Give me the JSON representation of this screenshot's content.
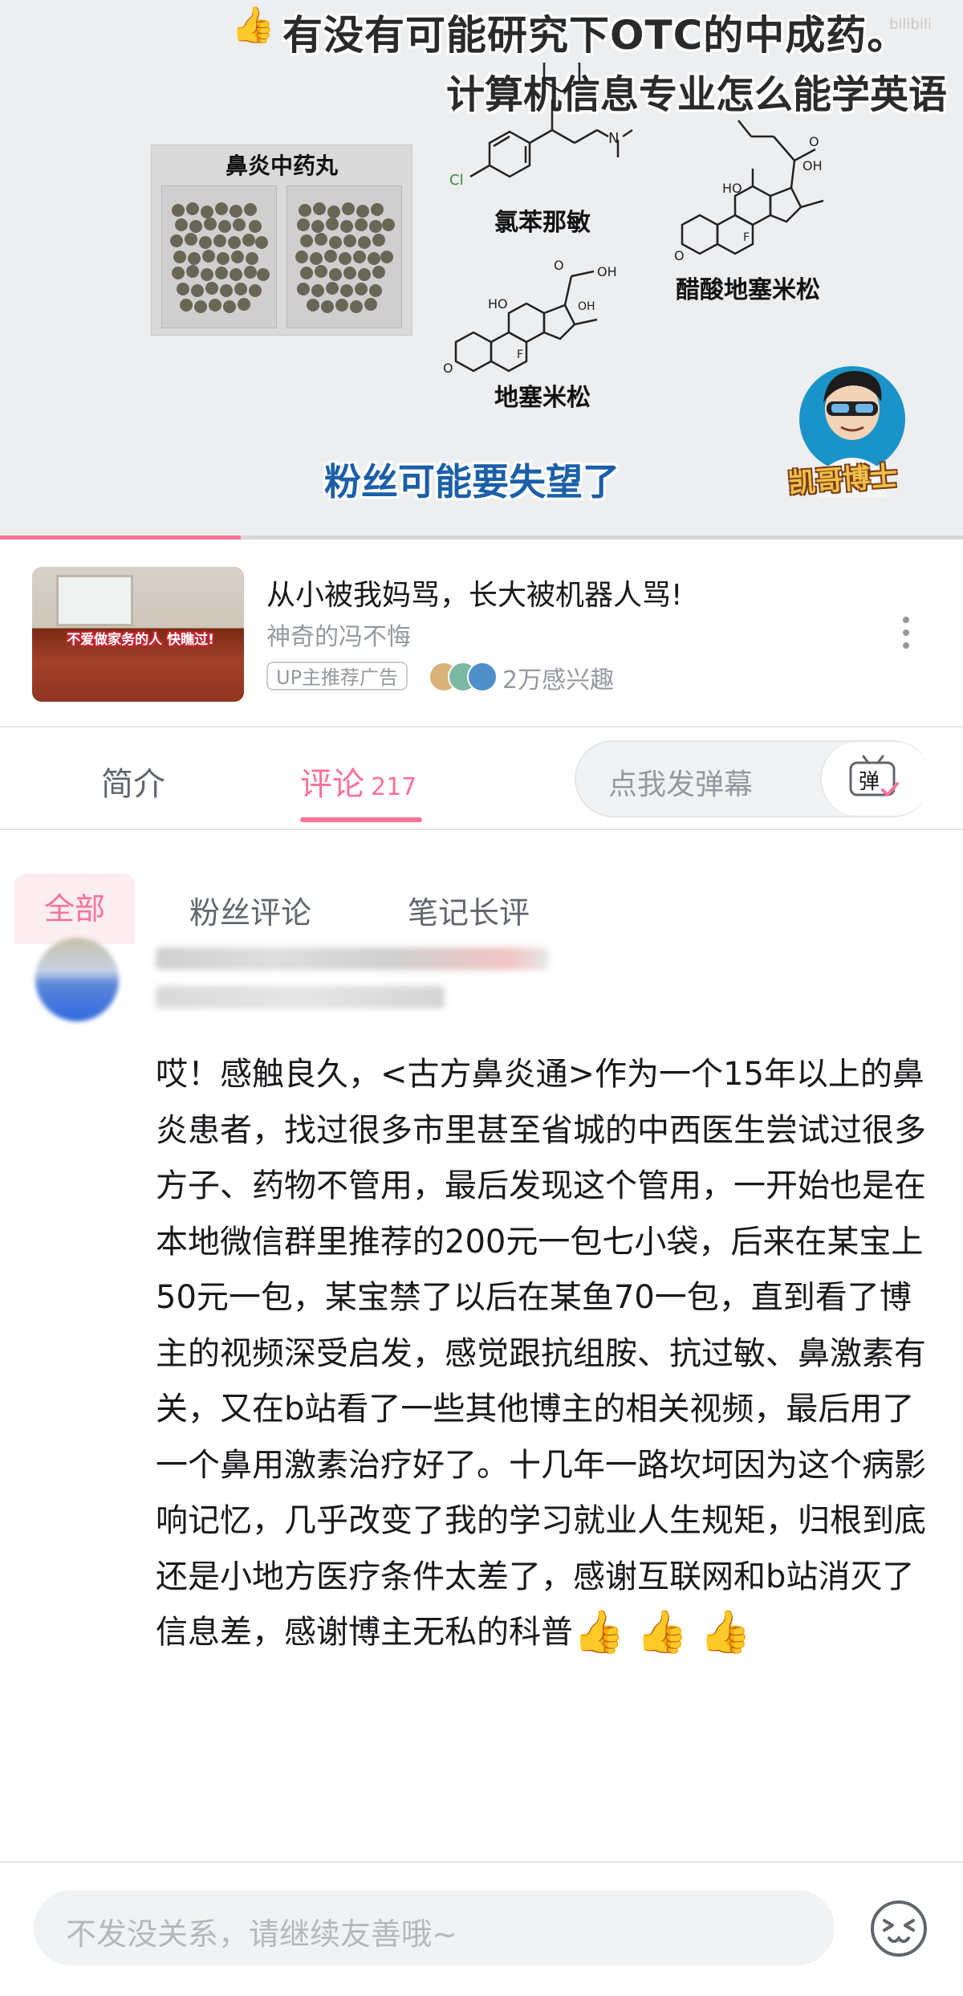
{
  "video": {
    "caption_top": "有没有可能研究下OTC的中成药。",
    "caption_second": "计算机信息专业怎么能学英语",
    "watermark": "bilibili",
    "pill_panel_label": "鼻炎中药丸",
    "chem_labels": [
      "氯苯那敏",
      "醋酸地塞米松",
      "地塞米松"
    ],
    "fans_caption": "粉丝可能要失望了",
    "channel_logo_text": "凯哥博士",
    "progress": 0.25
  },
  "ad": {
    "thumb_caption": "不爱做家务的人 快瞧过!",
    "title": "从小被我妈骂，长大被机器人骂!",
    "author": "神奇的冯不悔",
    "badge": "UP主推荐广告",
    "interest": "2万感兴趣"
  },
  "tabs": {
    "intro": "简介",
    "comments": "评论",
    "comments_count": "217",
    "danmu_placeholder": "点我发弹幕",
    "danmu_button": "弹"
  },
  "filters": {
    "all": "全部",
    "fans": "粉丝评论",
    "notes": "笔记长评"
  },
  "comment": {
    "text": "哎！感触良久，<古方鼻炎通>作为一个15年以上的鼻炎患者，找过很多市里甚至省城的中西医生尝试过很多方子、药物不管用，最后发现这个管用，一开始也是在本地微信群里推荐的200元一包七小袋，后来在某宝上50元一包，某宝禁了以后在某鱼70一包，直到看了博主的视频深受启发，感觉跟抗组胺、抗过敏、鼻激素有关，又在b站看了一些其他博主的相关视频，最后用了一个鼻用激素治疗好了。十几年一路坎坷因为这个病影响记忆，几乎改变了我的学习就业人生规矩，归根到底还是小地方医疗条件太差了，感谢互联网和b站消灭了信息差，感谢博主无私的科普",
    "emojis": "👍👍👍"
  },
  "bottom": {
    "reply_placeholder": "不发没关系，请继续友善哦~"
  },
  "colors": {
    "accent": "#fb7299",
    "text_primary": "#18191c",
    "text_secondary": "#61666d",
    "text_muted": "#9499a0"
  }
}
